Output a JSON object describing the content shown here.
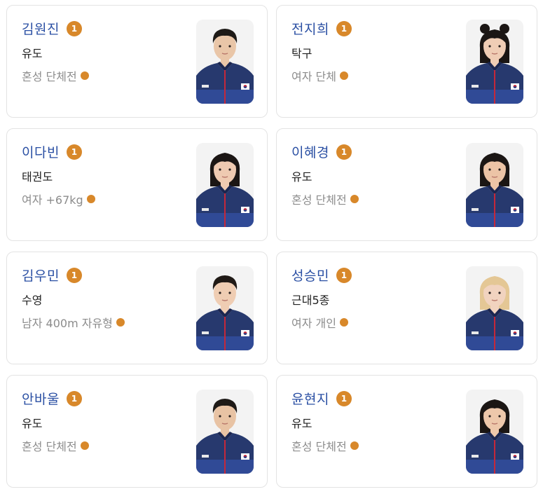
{
  "medal_color": "#d8882a",
  "name_color": "#2a4fa3",
  "athletes": [
    {
      "name": "김원진",
      "medal": "1",
      "sport": "유도",
      "event": "혼성 단체전",
      "hair": "#1e1a17",
      "long_hair": false,
      "buns": false,
      "skin": "#e9c6a8"
    },
    {
      "name": "전지희",
      "medal": "1",
      "sport": "탁구",
      "event": "여자 단체",
      "hair": "#1b1614",
      "long_hair": true,
      "buns": true,
      "skin": "#f0cdb5"
    },
    {
      "name": "이다빈",
      "medal": "1",
      "sport": "태권도",
      "event": "여자 +67kg",
      "hair": "#1b1614",
      "long_hair": true,
      "buns": false,
      "skin": "#efcab1"
    },
    {
      "name": "이혜경",
      "medal": "1",
      "sport": "유도",
      "event": "혼성 단체전",
      "hair": "#1b1614",
      "long_hair": true,
      "buns": false,
      "skin": "#ecc4a6"
    },
    {
      "name": "김우민",
      "medal": "1",
      "sport": "수영",
      "event": "남자 400m 자유형",
      "hair": "#201a16",
      "long_hair": false,
      "buns": false,
      "skin": "#efcdb3"
    },
    {
      "name": "성승민",
      "medal": "1",
      "sport": "근대5종",
      "event": "여자 개인",
      "hair": "#e4c795",
      "long_hair": true,
      "buns": false,
      "skin": "#f1d3bf"
    },
    {
      "name": "안바울",
      "medal": "1",
      "sport": "유도",
      "event": "혼성 단체전",
      "hair": "#1e1a17",
      "long_hair": false,
      "buns": false,
      "skin": "#e8c3a4"
    },
    {
      "name": "윤현지",
      "medal": "1",
      "sport": "유도",
      "event": "혼성 단체전",
      "hair": "#1b1614",
      "long_hair": true,
      "buns": false,
      "skin": "#eec8ab"
    }
  ]
}
